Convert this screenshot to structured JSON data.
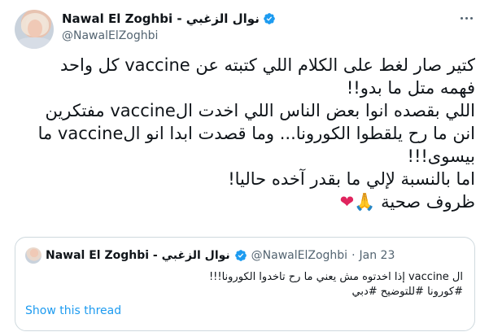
{
  "author": {
    "display_name": "Nawal El Zoghbi - نوال الزغبي",
    "handle": "@NawalElZoghbi"
  },
  "tweet": {
    "lines": [
      "كتير صار لغط على الكلام اللي كتبته عن vaccine كل واحد",
      "فهمه متل ما بدو!!",
      "اللي بقصده انوا بعض الناس اللي اخدت الvaccine مفتكرين",
      "انن ما رح يلقطوا الكورونا... وما قصدت ابدا انو الvaccine ما",
      "بيسوى!!!",
      "اما بالنسبة لإلي ما بقدر آخده حاليا!"
    ],
    "last_line_text": "ظروف صحية",
    "emoji_pray": "🙏",
    "emoji_heart": "❤"
  },
  "quote": {
    "display_name": "Nawal El Zoghbi - نوال الزغبي",
    "handle": "@NawalElZoghbi",
    "separator": "·",
    "date": "Jan 23",
    "lines": [
      "ال vaccine إذا اخدتوه مش يعني ما رح تاخدوا الكورونا!!!",
      "#كورونا #للتوضيح #دبي"
    ],
    "show_thread": "Show this thread"
  },
  "colors": {
    "verified": "#1d9bf0",
    "link": "#1d9bf0",
    "muted": "#536471",
    "border": "#cfd9de"
  },
  "icons": {
    "verified": "verified-badge-icon",
    "more": "more-dots-icon"
  }
}
